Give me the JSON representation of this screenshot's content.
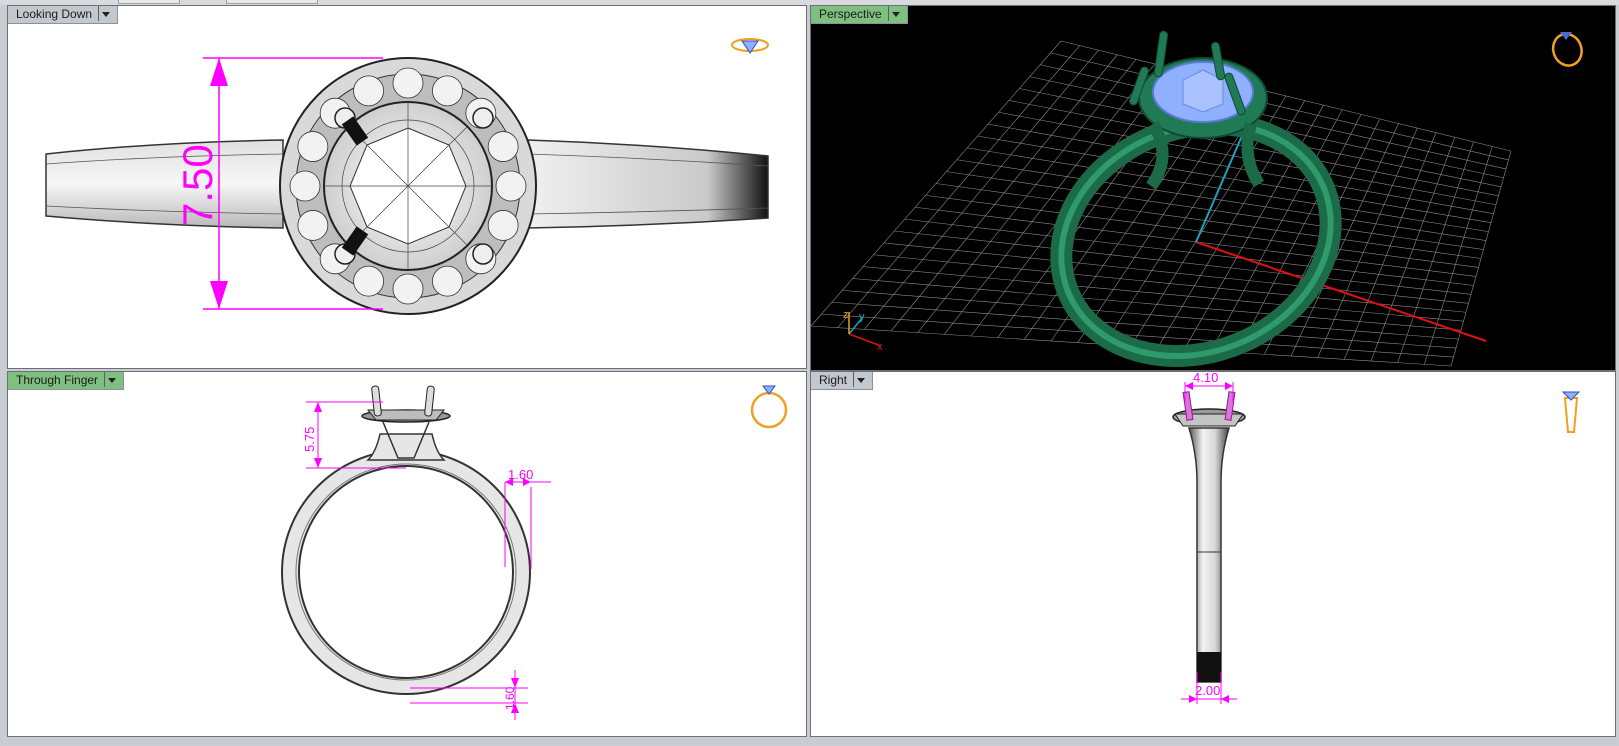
{
  "viewports": {
    "top_left": {
      "label": "Looking Down",
      "dimension": "7.50"
    },
    "top_right": {
      "label": "Perspective",
      "axis_y": "y",
      "axis_z": "z",
      "axis_x": "x"
    },
    "bottom_left": {
      "label": "Through Finger",
      "dim_height": "5.75",
      "dim_shank_side": "1.60",
      "dim_shank_bottom": "1.60"
    },
    "bottom_right": {
      "label": "Right",
      "dim_top": "4.10",
      "dim_bottom": "2.00"
    }
  },
  "icons": {
    "looking_down": "ring-top-view-icon",
    "perspective": "ring-perspective-icon",
    "through_finger": "ring-front-view-icon",
    "right": "ring-side-view-icon"
  },
  "colors": {
    "dimension": "#ff00ff",
    "active_label": "#7fbf7f",
    "ring_green": "#1f7a55",
    "stone_blue": "#8fb0ff",
    "icon_orange": "#f0a020"
  }
}
